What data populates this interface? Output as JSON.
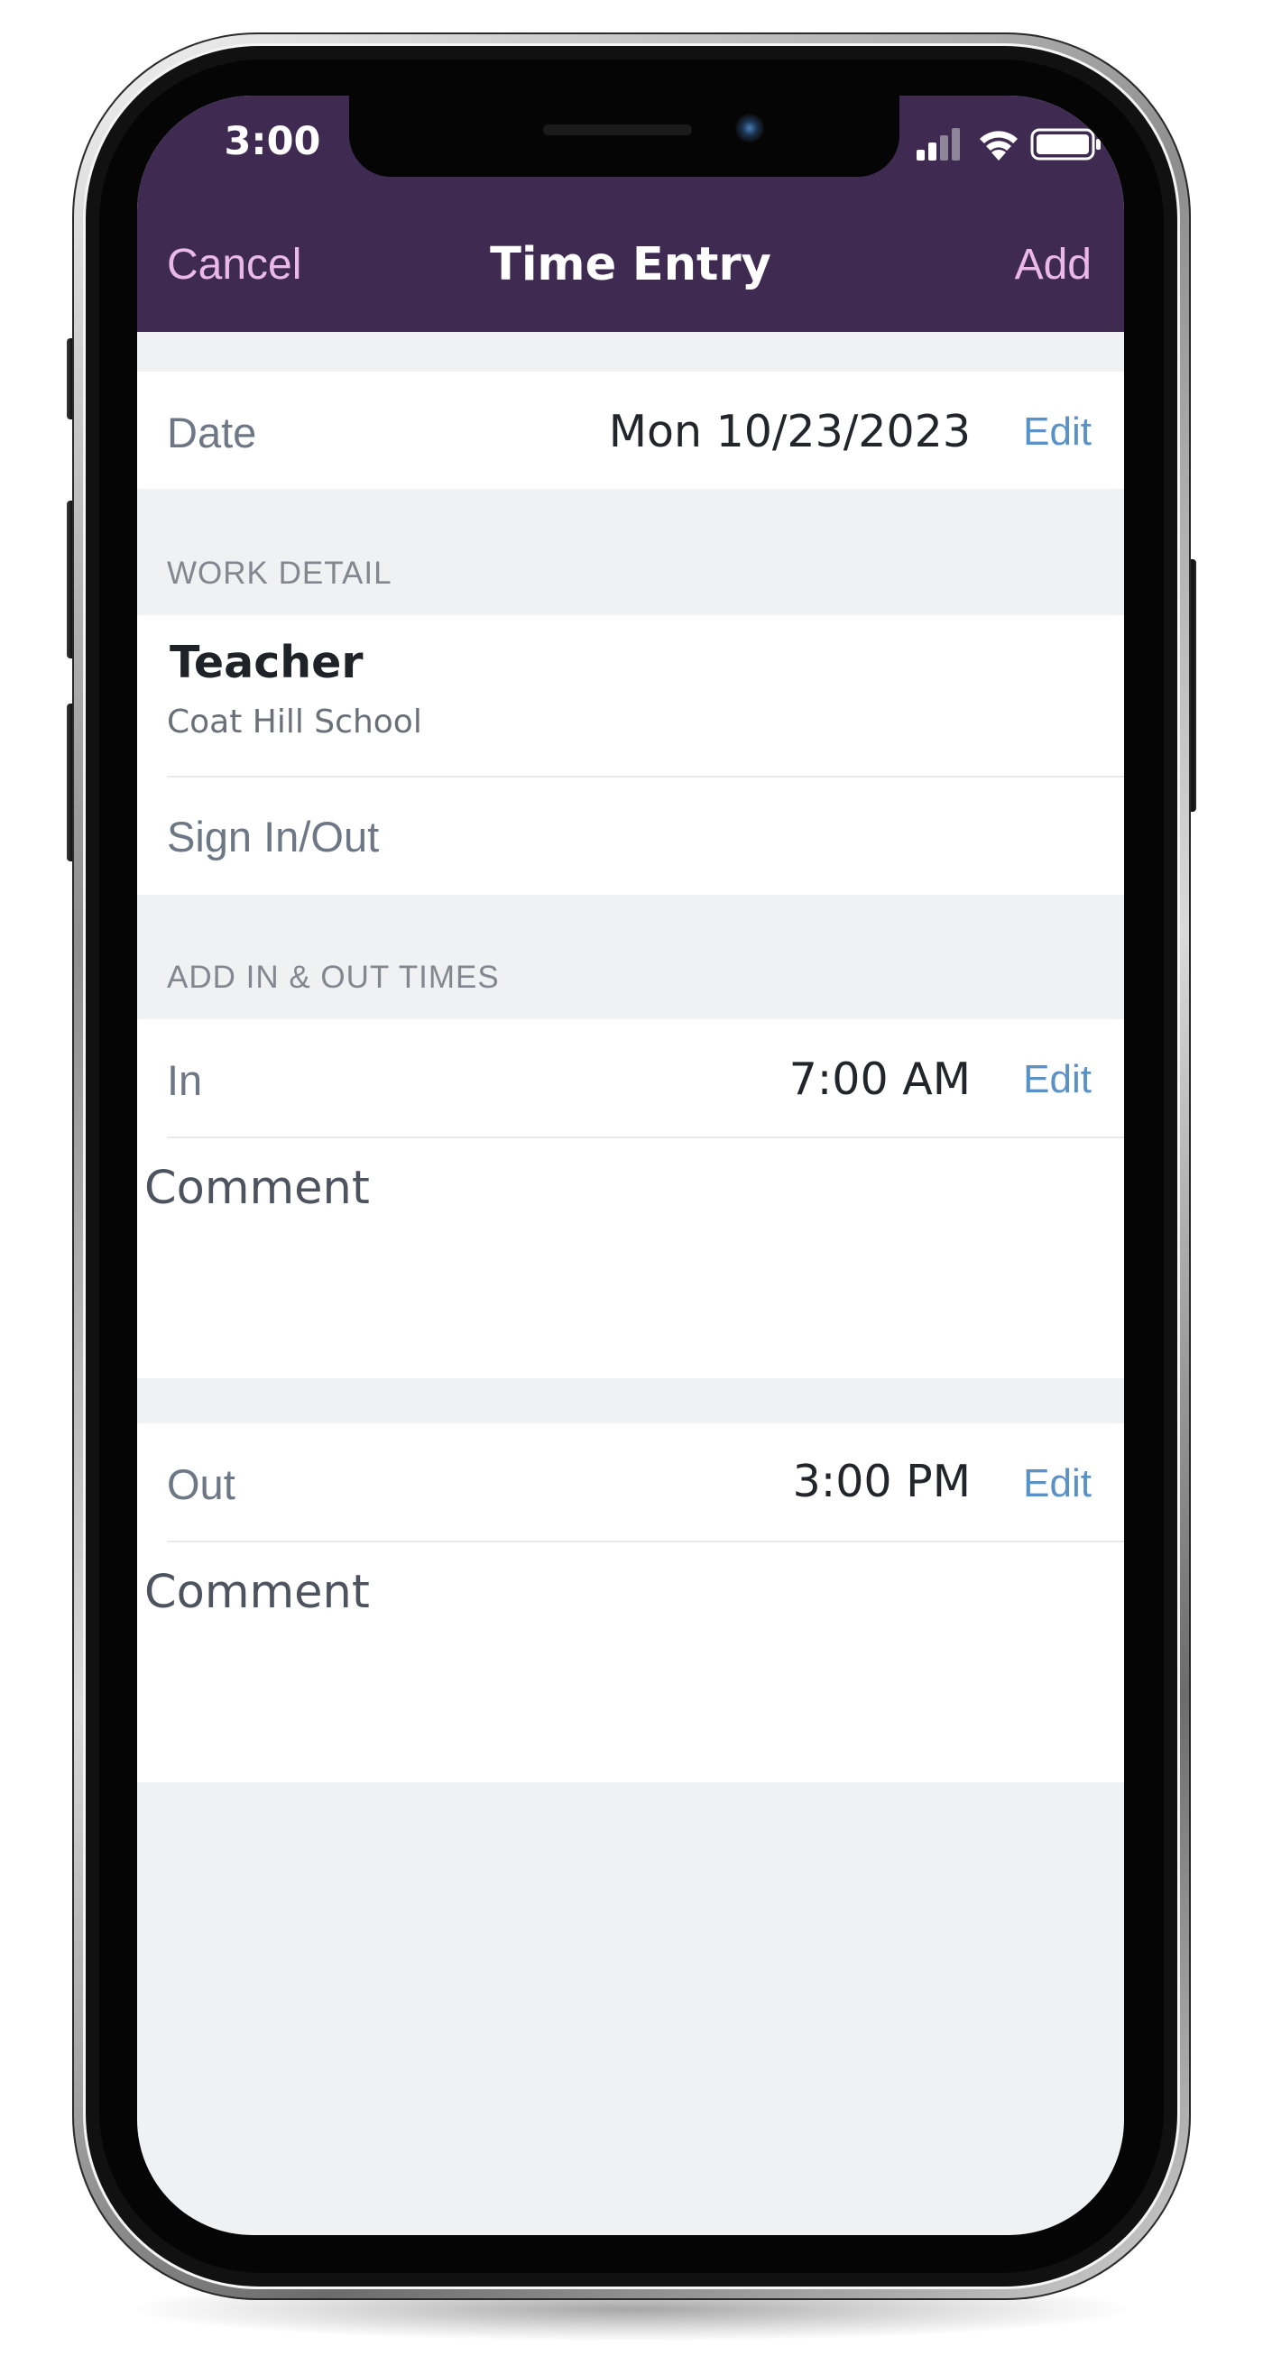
{
  "status_bar": {
    "time": "3:00"
  },
  "nav": {
    "cancel_label": "Cancel",
    "title": "Time Entry",
    "add_label": "Add"
  },
  "date_row": {
    "label": "Date",
    "value": "Mon 10/23/2023",
    "edit_label": "Edit"
  },
  "work_detail": {
    "header": "WORK DETAIL",
    "job_title": "Teacher",
    "job_location": "Coat Hill School",
    "sign_in_out_label": "Sign In/Out"
  },
  "times": {
    "header": "ADD IN & OUT TIMES",
    "in": {
      "label": "In",
      "value": "7:00 AM",
      "edit_label": "Edit",
      "comment_label": "Comment",
      "comment_value": ""
    },
    "out": {
      "label": "Out",
      "value": "3:00 PM",
      "edit_label": "Edit",
      "comment_label": "Comment",
      "comment_value": ""
    }
  },
  "icons": {
    "cellular": "cellular-signal-icon",
    "wifi": "wifi-icon",
    "battery": "battery-icon"
  },
  "colors": {
    "header_bg": "#3f2b52",
    "nav_button": "#eab9ea",
    "edit_link": "#5a92c8",
    "screen_bg": "#f0f1f3"
  }
}
